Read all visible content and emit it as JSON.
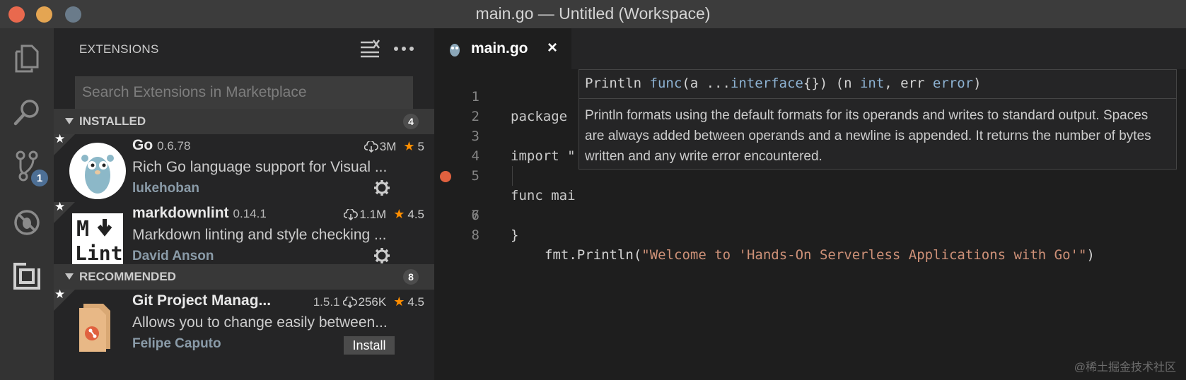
{
  "window": {
    "title": "main.go — Untitled (Workspace)"
  },
  "activity_bar": {
    "items": [
      "explorer-icon",
      "search-icon",
      "source-control-icon",
      "debug-icon",
      "extensions-icon"
    ],
    "source_control_badge": "1"
  },
  "sidebar": {
    "title": "EXTENSIONS",
    "search_placeholder": "Search Extensions in Marketplace",
    "sections": [
      {
        "label": "INSTALLED",
        "count": "4"
      },
      {
        "label": "RECOMMENDED",
        "count": "8"
      }
    ],
    "extensions": [
      {
        "name": "Go",
        "version": "0.6.78",
        "downloads": "3M",
        "rating": "5",
        "description": "Rich Go language support for Visual ...",
        "author": "lukehoban",
        "action": "gear"
      },
      {
        "name": "markdownlint",
        "version": "0.14.1",
        "downloads": "1.1M",
        "rating": "4.5",
        "description": "Markdown linting and style checking ...",
        "author": "David Anson",
        "action": "gear"
      },
      {
        "name": "Git Project Manag...",
        "version": "1.5.1",
        "downloads": "256K",
        "rating": "4.5",
        "description": "Allows you to change easily between...",
        "author": "Felipe Caputo",
        "action_label": "Install"
      }
    ]
  },
  "editor": {
    "tab_label": "main.go",
    "tab_close": "×",
    "lines": [
      {
        "n": "1",
        "text": "package"
      },
      {
        "n": "2",
        "text": ""
      },
      {
        "n": "3",
        "text": "import \""
      },
      {
        "n": "4",
        "text": ""
      },
      {
        "n": "5",
        "text": "func mai"
      },
      {
        "n": "6",
        "text_prefix": "fmt.Println(",
        "string": "\"Welcome to 'Hands-On Serverless Applications with Go'\"",
        "text_suffix": ")"
      },
      {
        "n": "7",
        "text": "}"
      },
      {
        "n": "8",
        "text": ""
      }
    ]
  },
  "hover": {
    "sig_name": "Println ",
    "sig_func": "func",
    "sig_a": "(a ...",
    "sig_iface": "interface",
    "sig_mid": "{}) (n ",
    "sig_int": "int",
    "sig_err": ", err ",
    "sig_error": "error",
    "sig_close": ")",
    "doc": "Println formats using the default formats for its operands and writes to standard output. Spaces are always added between operands and a newline is appended. It returns the number of bytes written and any write error encountered."
  },
  "watermark": "@稀土掘金技术社区",
  "colors": {
    "accent_star": "#ff8e00",
    "breakpoint": "#e0613f",
    "string": "#ce9178",
    "badge": "#4d6f95"
  }
}
